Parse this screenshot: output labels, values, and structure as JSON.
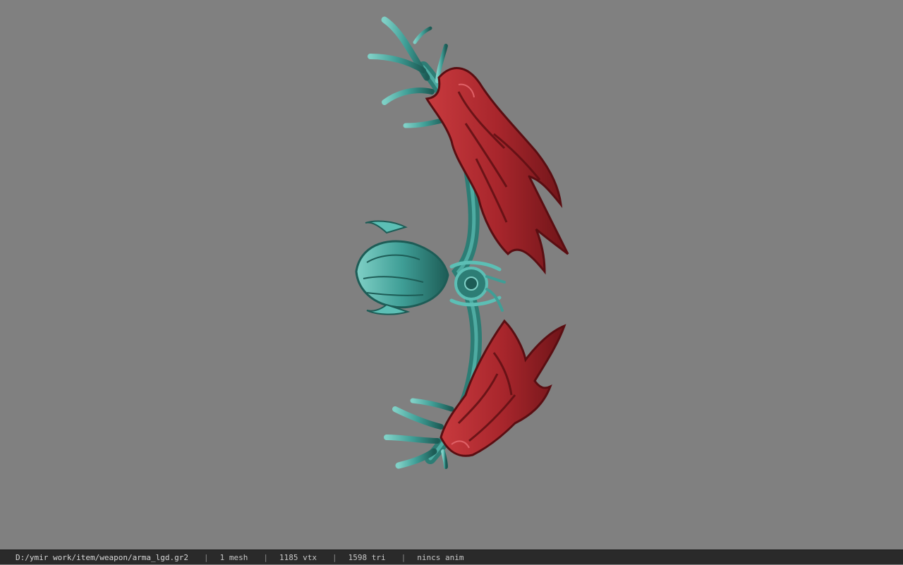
{
  "status": {
    "path": "D:/ymir work/item/weapon/arma_lgd.gr2",
    "separator": "|",
    "mesh": "1 mesh",
    "vtx": "1185 vtx",
    "tri": "1598 tri",
    "anim": "nincs anim"
  },
  "colors": {
    "background": "#808080",
    "teal": "#3f9e96",
    "red": "#a8262c"
  }
}
